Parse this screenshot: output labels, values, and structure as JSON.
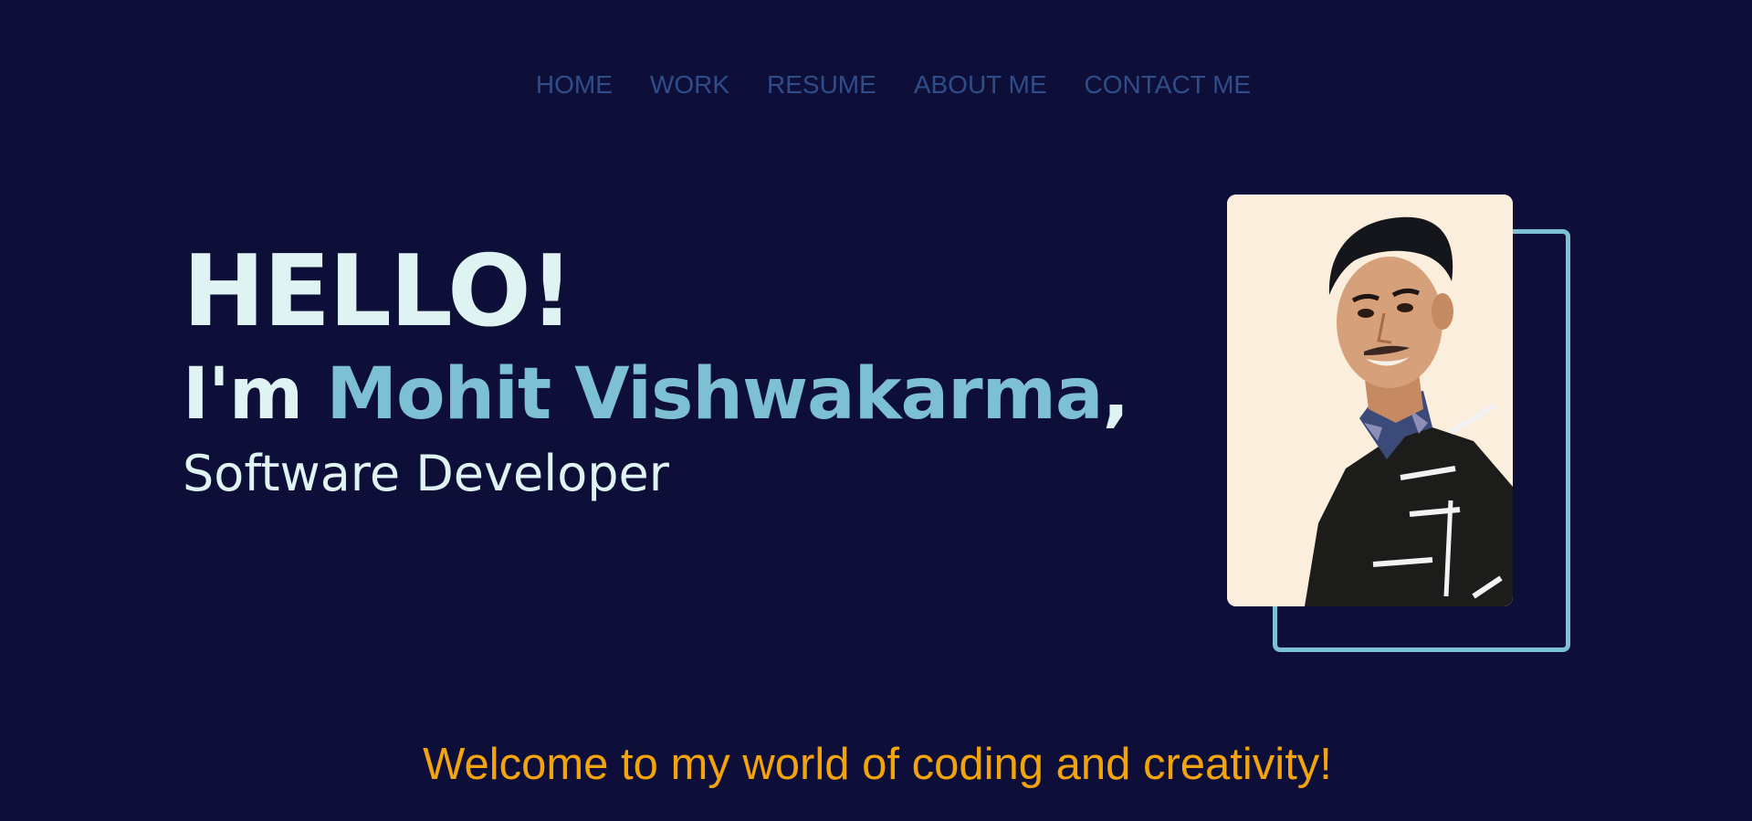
{
  "nav": {
    "items": [
      {
        "label": "HOME"
      },
      {
        "label": "WORK"
      },
      {
        "label": "RESUME"
      },
      {
        "label": "ABOUT ME"
      },
      {
        "label": "CONTACT ME"
      }
    ]
  },
  "hero": {
    "greeting": "HELLO!",
    "intro_prefix": "I'm ",
    "name": "Mohit Vishwakarma",
    "intro_suffix": ",",
    "role": "Software Developer"
  },
  "welcome": {
    "text": "Welcome to my world of coding and creativity!"
  },
  "colors": {
    "background": "#0e0f38",
    "nav_link": "#2f4d89",
    "accent": "#7dc0d4",
    "text_light": "#dff3f2",
    "welcome": "#f3a40c",
    "portrait_bg": "#fbeedd"
  },
  "portrait": {
    "icon": "person-photo"
  }
}
